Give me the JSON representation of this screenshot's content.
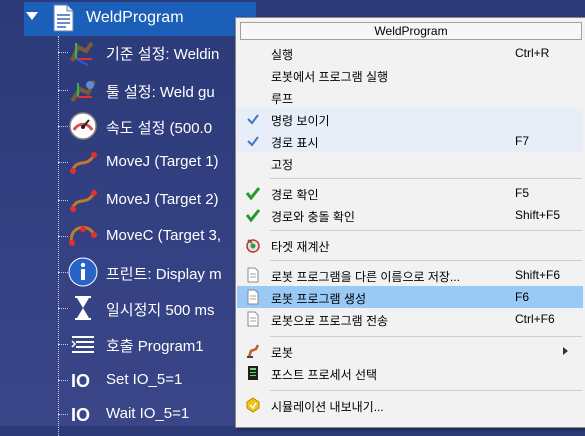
{
  "tree": {
    "root_label": "WeldProgram",
    "items": [
      {
        "label": "기준 설정: Weldin",
        "icon": "reference-frame-icon"
      },
      {
        "label": "툴 설정: Weld gu",
        "icon": "tool-icon"
      },
      {
        "label": "속도 설정 (500.0 ",
        "icon": "speedometer-icon"
      },
      {
        "label": "MoveJ (Target 1)",
        "icon": "movej-icon"
      },
      {
        "label": "MoveJ (Target 2)",
        "icon": "movej-icon"
      },
      {
        "label": "MoveC (Target 3,",
        "icon": "movec-icon"
      },
      {
        "label": "프린트: Display m",
        "icon": "info-icon"
      },
      {
        "label": "일시정지 500 ms",
        "icon": "hourglass-icon"
      },
      {
        "label": "호출 Program1",
        "icon": "call-program-icon"
      },
      {
        "label": "Set IO_5=1",
        "icon": "io-icon"
      },
      {
        "label": "Wait IO_5=1",
        "icon": "io-icon"
      }
    ]
  },
  "menu": {
    "title": "WeldProgram",
    "items": [
      {
        "label": "실행",
        "shortcut": "Ctrl+R"
      },
      {
        "label": "로봇에서 프로그램 실행",
        "shortcut": ""
      },
      {
        "label": "루프",
        "shortcut": ""
      },
      {
        "label": "명령 보이기",
        "shortcut": ""
      },
      {
        "label": "경로 표시",
        "shortcut": "F7"
      },
      {
        "label": "고정",
        "shortcut": ""
      },
      {
        "label": "경로 확인",
        "shortcut": "F5"
      },
      {
        "label": "경로와 충돌 확인",
        "shortcut": "Shift+F5"
      },
      {
        "label": "타겟 재계산",
        "shortcut": ""
      },
      {
        "label": "로봇 프로그램을 다른 이름으로 저장...",
        "shortcut": "Shift+F6"
      },
      {
        "label": "로봇 프로그램 생성",
        "shortcut": "F6"
      },
      {
        "label": "로봇으로 프로그램 전송",
        "shortcut": "Ctrl+F6"
      },
      {
        "label": "로봇",
        "shortcut": ""
      },
      {
        "label": "포스트 프로세서 선택",
        "shortcut": ""
      },
      {
        "label": "시뮬레이션 내보내기...",
        "shortcut": ""
      }
    ]
  },
  "colors": {
    "background": "#323f80",
    "selection": "#1b5fb8",
    "menu_highlight": "#99c9f5",
    "check_blue": "#3a78c8",
    "check_green": "#1f9a2c"
  }
}
